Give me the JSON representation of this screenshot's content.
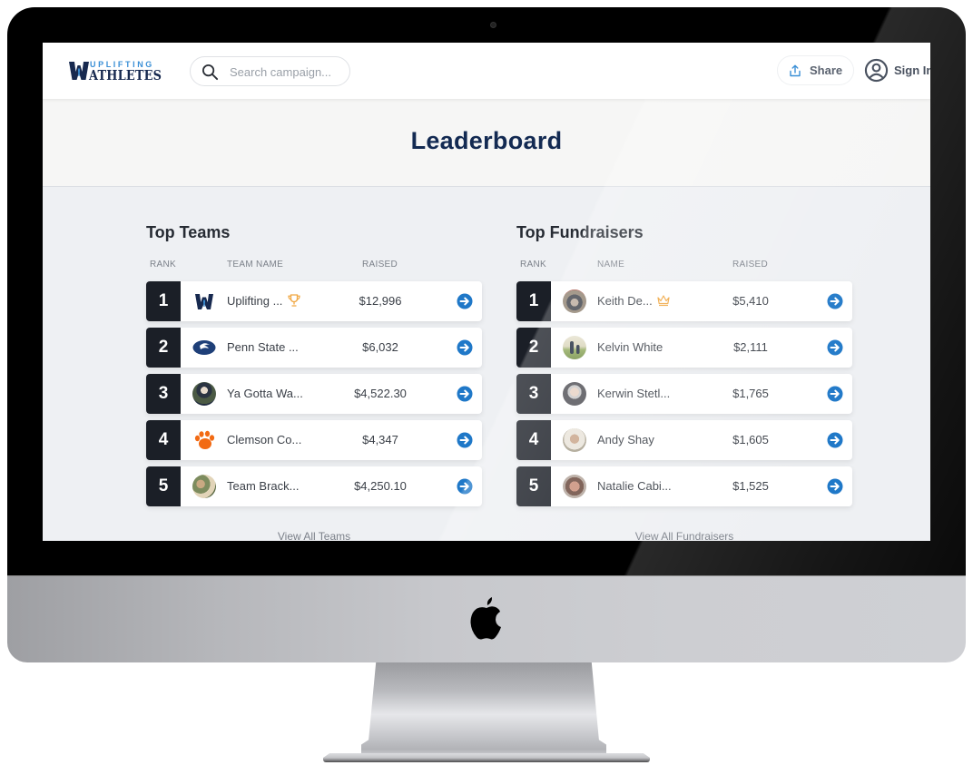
{
  "header": {
    "logo_top": "UPLIFTING",
    "logo_bottom": "ATHLETES",
    "search_placeholder": "Search campaign...",
    "share_label": "Share",
    "signin_label": "Sign In"
  },
  "hero": {
    "title": "Leaderboard"
  },
  "teams": {
    "title": "Top Teams",
    "columns": {
      "rank": "RANK",
      "name": "TEAM NAME",
      "raised": "RAISED"
    },
    "rows": [
      {
        "rank": "1",
        "name": "Uplifting ...",
        "raised": "$12,996",
        "avatar": "uplifting-athletes-logo",
        "badge": "trophy-icon"
      },
      {
        "rank": "2",
        "name": "Penn State ...",
        "raised": "$6,032",
        "avatar": "penn-state-logo"
      },
      {
        "rank": "3",
        "name": "Ya Gotta Wa...",
        "raised": "$4,522.30",
        "avatar": "person-photo"
      },
      {
        "rank": "4",
        "name": "Clemson Co...",
        "raised": "$4,347",
        "avatar": "clemson-paw-logo"
      },
      {
        "rank": "5",
        "name": "Team Brack...",
        "raised": "$4,250.10",
        "avatar": "group-photo"
      }
    ],
    "view_all": "View All Teams"
  },
  "fundraisers": {
    "title": "Top Fundraisers",
    "columns": {
      "rank": "RANK",
      "name": "NAME",
      "raised": "RAISED"
    },
    "rows": [
      {
        "rank": "1",
        "name": "Keith De...",
        "raised": "$5,410",
        "avatar": "person-photo",
        "badge": "crown-icon"
      },
      {
        "rank": "2",
        "name": "Kelvin White",
        "raised": "$2,111",
        "avatar": "person-photo"
      },
      {
        "rank": "3",
        "name": "Kerwin Stetl...",
        "raised": "$1,765",
        "avatar": "person-photo"
      },
      {
        "rank": "4",
        "name": "Andy Shay",
        "raised": "$1,605",
        "avatar": "person-photo"
      },
      {
        "rank": "5",
        "name": "Natalie Cabi...",
        "raised": "$1,525",
        "avatar": "person-photo"
      }
    ],
    "view_all": "View All Fundraisers"
  },
  "colors": {
    "brand_navy": "#132a52",
    "brand_blue": "#3a8fd6",
    "action_blue": "#1f78c8",
    "rank_bg": "#1b1f27",
    "trophy_gold": "#f0a640"
  }
}
